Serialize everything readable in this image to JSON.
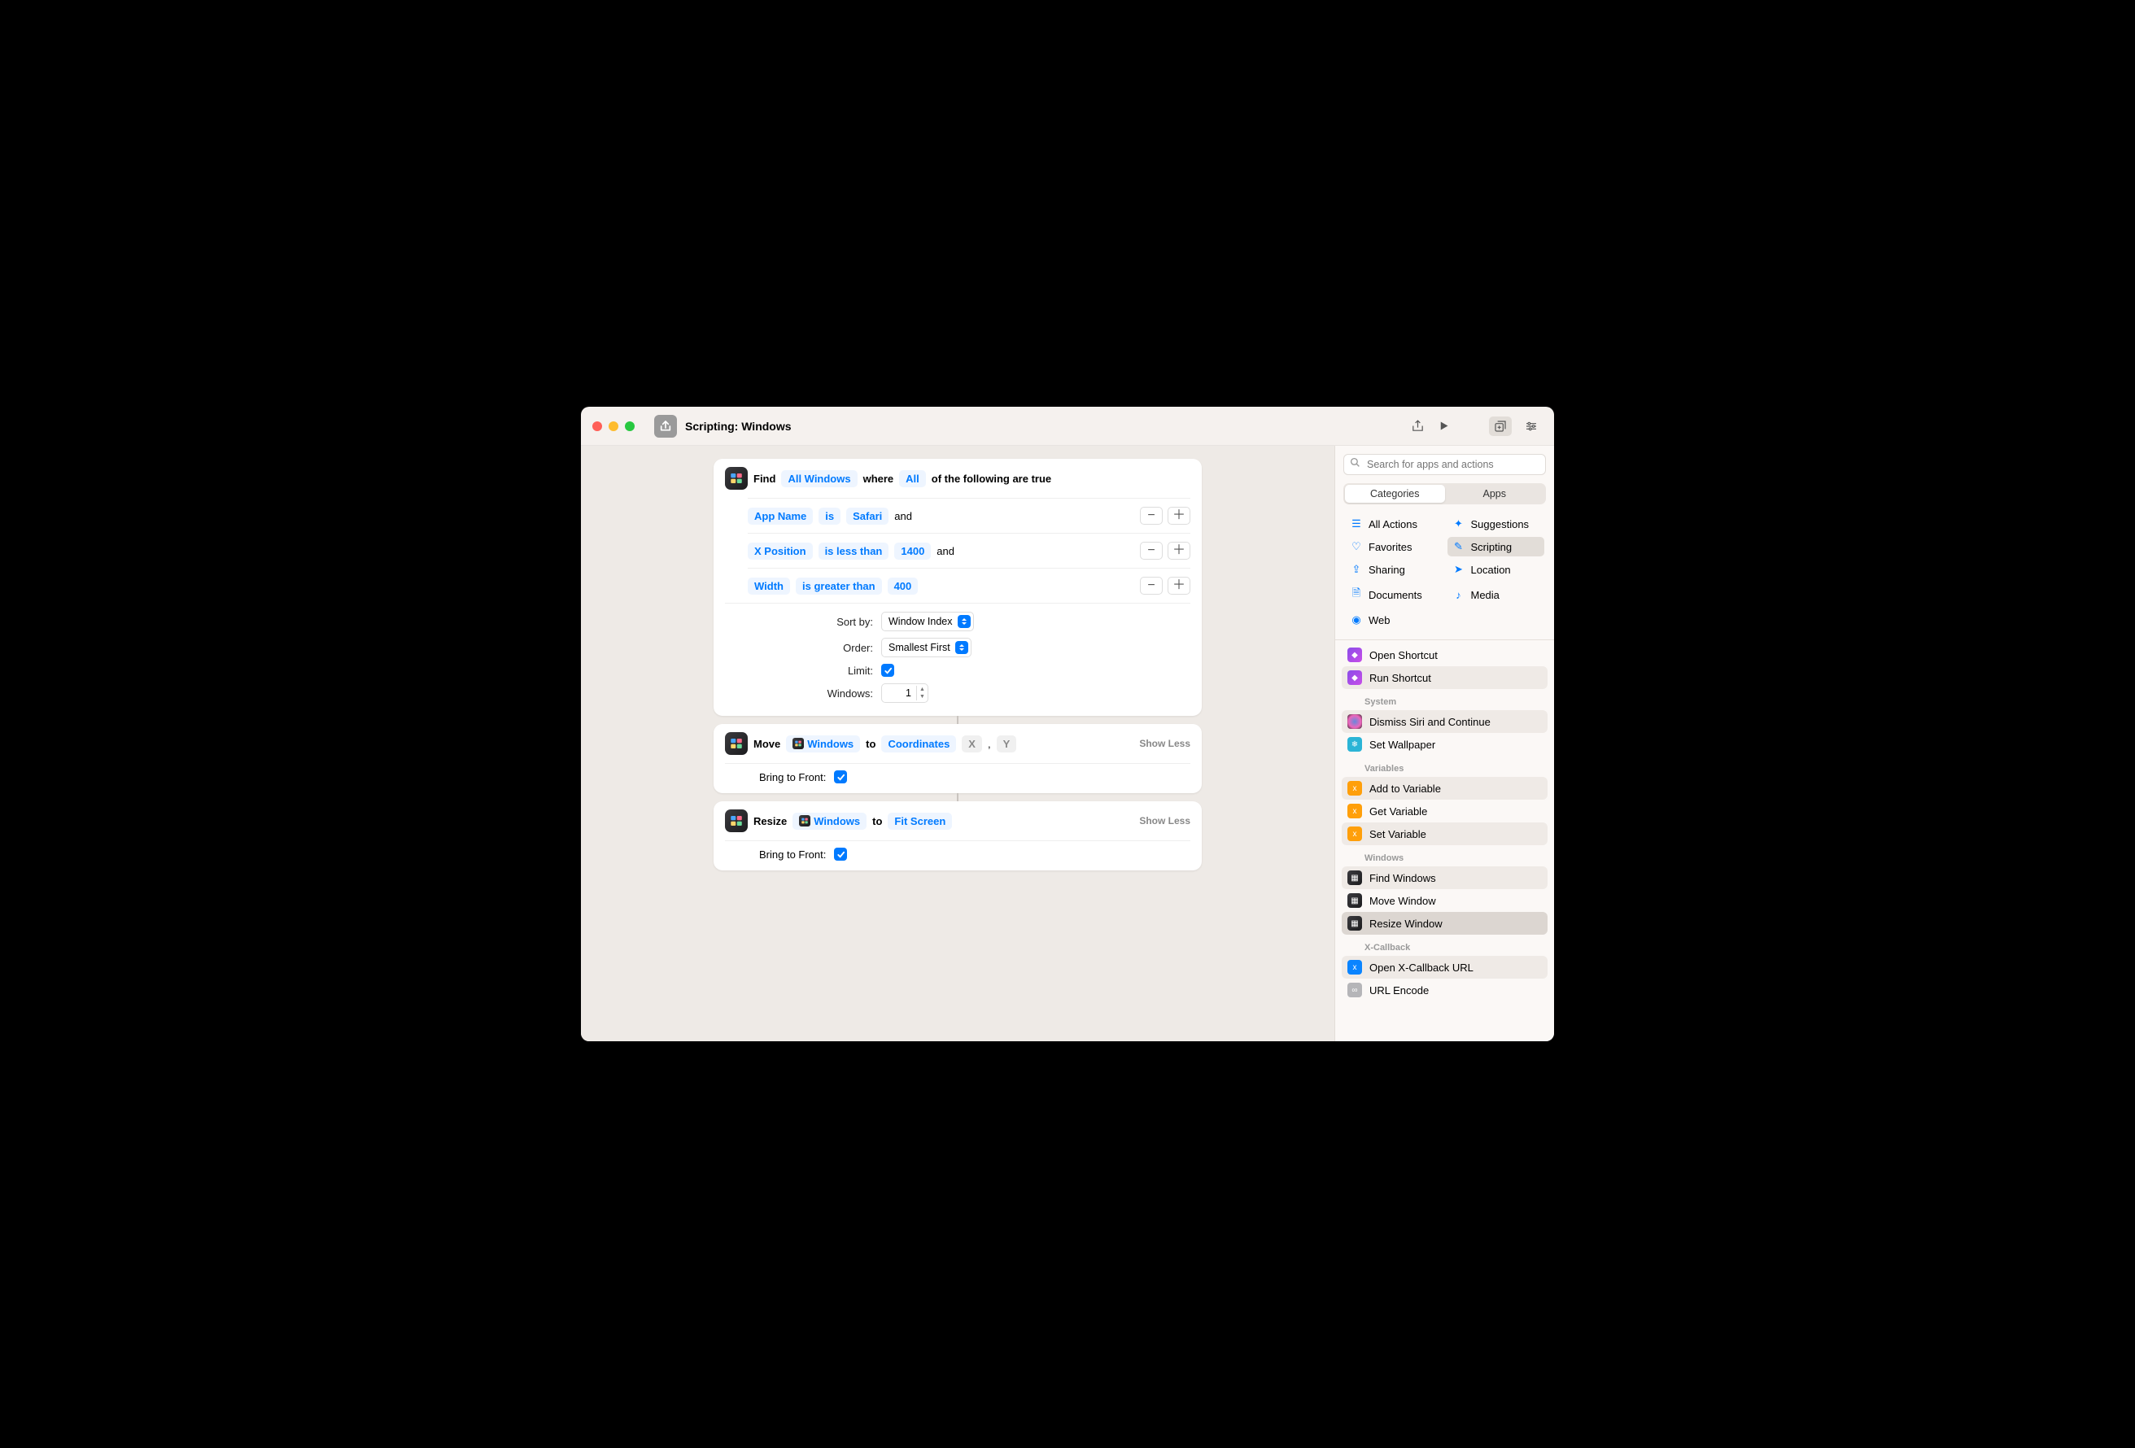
{
  "title": "Scripting: Windows",
  "actions": {
    "find": {
      "verb": "Find",
      "scope": "All Windows",
      "where": "where",
      "match": "All",
      "suffix": "of the following are true",
      "filters": [
        {
          "field": "App Name",
          "op": "is",
          "value": "Safari",
          "tail": "and"
        },
        {
          "field": "X Position",
          "op": "is less than",
          "value": "1400",
          "tail": "and"
        },
        {
          "field": "Width",
          "op": "is greater than",
          "value": "400",
          "tail": ""
        }
      ],
      "options": {
        "sort_by_label": "Sort by:",
        "sort_by_value": "Window Index",
        "order_label": "Order:",
        "order_value": "Smallest First",
        "limit_label": "Limit:",
        "limit_checked": true,
        "windows_label": "Windows:",
        "windows_value": "1"
      }
    },
    "move": {
      "verb": "Move",
      "target": "Windows",
      "to": "to",
      "coord_label": "Coordinates",
      "x": "X",
      "y": "Y",
      "show_less": "Show Less",
      "bring_label": "Bring to Front:",
      "bring_checked": true
    },
    "resize": {
      "verb": "Resize",
      "target": "Windows",
      "to": "to",
      "mode": "Fit Screen",
      "show_less": "Show Less",
      "bring_label": "Bring to Front:",
      "bring_checked": true
    }
  },
  "sidebar": {
    "search_placeholder": "Search for apps and actions",
    "seg_categories": "Categories",
    "seg_apps": "Apps",
    "categories": {
      "all": "All Actions",
      "suggestions": "Suggestions",
      "favorites": "Favorites",
      "scripting": "Scripting",
      "sharing": "Sharing",
      "location": "Location",
      "documents": "Documents",
      "media": "Media",
      "web": "Web"
    },
    "list": {
      "open_shortcut": "Open Shortcut",
      "run_shortcut": "Run Shortcut",
      "sec_system": "System",
      "dismiss_siri": "Dismiss Siri and Continue",
      "set_wallpaper": "Set Wallpaper",
      "sec_variables": "Variables",
      "add_var": "Add to Variable",
      "get_var": "Get Variable",
      "set_var": "Set Variable",
      "sec_windows": "Windows",
      "find_windows": "Find Windows",
      "move_window": "Move Window",
      "resize_window": "Resize Window",
      "sec_xcb": "X-Callback",
      "open_xcb": "Open X-Callback URL",
      "url_encode": "URL Encode"
    }
  }
}
